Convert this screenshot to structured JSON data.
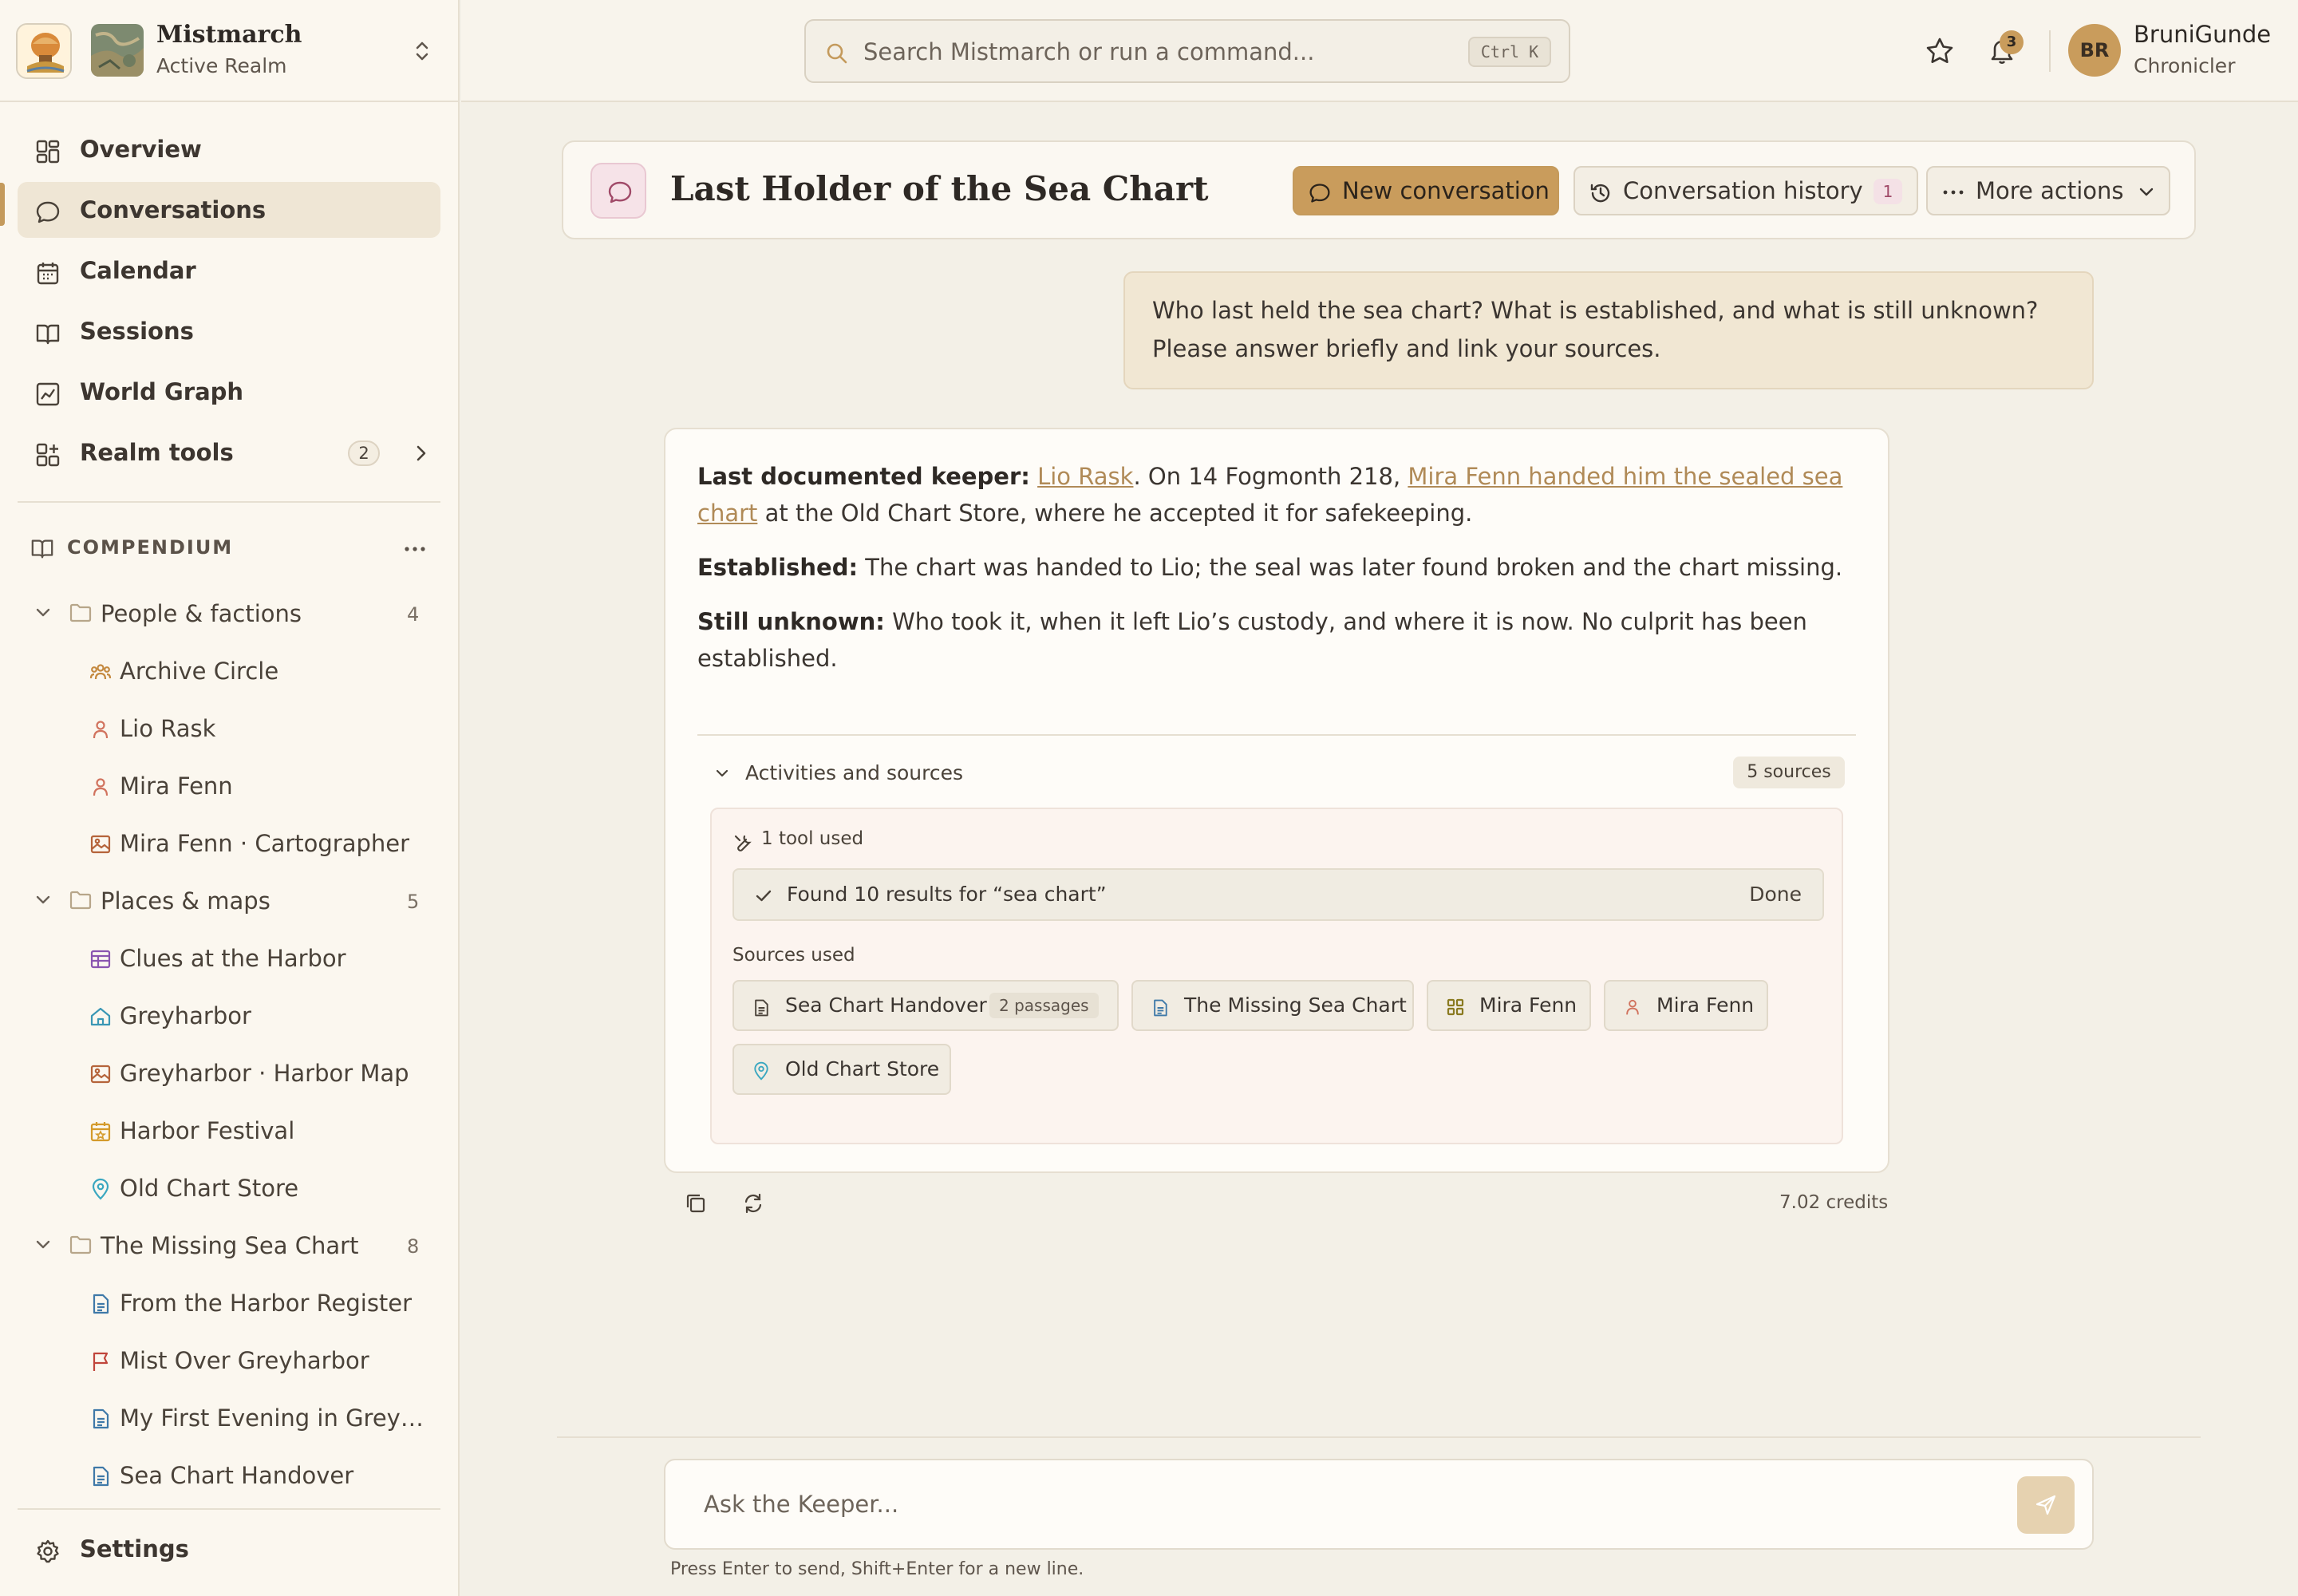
{
  "realm": {
    "name": "Mistmarch",
    "subtitle": "Active Realm"
  },
  "nav": {
    "overview": "Overview",
    "conversations": "Conversations",
    "calendar": "Calendar",
    "sessions": "Sessions",
    "world_graph": "World Graph",
    "realm_tools": "Realm tools",
    "realm_tools_count": "2",
    "settings": "Settings"
  },
  "compendium": {
    "title": "COMPENDIUM",
    "folders": [
      {
        "label": "People & factions",
        "count": "4",
        "items": [
          "Archive Circle",
          "Lio Rask",
          "Mira Fenn",
          "Mira Fenn · Cartographer"
        ]
      },
      {
        "label": "Places & maps",
        "count": "5",
        "items": [
          "Clues at the Harbor",
          "Greyharbor",
          "Greyharbor · Harbor Map",
          "Harbor Festival",
          "Old Chart Store"
        ]
      },
      {
        "label": "The Missing Sea Chart",
        "count": "8",
        "items": [
          "From the Harbor Register",
          "Mist Over Greyharbor",
          "My First Evening in Grey…",
          "Sea Chart Handover"
        ]
      }
    ]
  },
  "topbar": {
    "search_placeholder": "Search Mistmarch or run a command...",
    "shortcut": "Ctrl K",
    "notifications_count": "3",
    "user_initials": "BR",
    "user_name": "BruniGunde",
    "user_role": "Chronicler"
  },
  "conversation": {
    "title": "Last Holder of the Sea Chart",
    "new_label": "New conversation",
    "history_label": "Conversation history",
    "history_count": "1",
    "more_label": "More actions"
  },
  "user_message": {
    "line1": "Who last held the sea chart? What is established, and what is still unknown?",
    "line2": "Please answer briefly and link your sources."
  },
  "answer": {
    "keeper_label": "Last documented keeper:",
    "keeper_link": "Lio Rask",
    "keeper_text1": ". On 14 Fogmonth 218,",
    "keeper_link2a": "Mira Fenn handed him the sealed sea",
    "keeper_link2b": "chart",
    "keeper_text2": " at the Old Chart Store, where he accepted it for safekeeping.",
    "established_label": "Established:",
    "established_text": " The chart was handed to Lio; the seal was later found broken and the chart missing.",
    "unknown_label": "Still unknown:",
    "unknown_text1": " Who took it, when it left Lio’s custody, and where it is now. No culprit has been",
    "unknown_text2": "established."
  },
  "activities": {
    "header": "Activities and sources",
    "sources_count": "5 sources",
    "tools_used": "1 tool used",
    "result_text": "Found 10 results for “sea chart”",
    "result_status": "Done",
    "sources_used_label": "Sources used",
    "sources": [
      {
        "label": "Sea Chart Handover",
        "icon": "document-icon",
        "passages": "2 passages"
      },
      {
        "label": "The Missing Sea Chart",
        "icon": "document-icon"
      },
      {
        "label": "Mira Fenn",
        "icon": "grid-icon"
      },
      {
        "label": "Mira Fenn",
        "icon": "person-icon"
      },
      {
        "label": "Old Chart Store",
        "icon": "location-pin-icon"
      }
    ]
  },
  "credits": "7.02 credits",
  "composer": {
    "placeholder": "Ask the Keeper...",
    "hint": "Press Enter to send, Shift+Enter for a new line."
  },
  "colors": {
    "accent": "#c99c5c",
    "background": "#f3f0e7",
    "sidebar": "#fbf7ef",
    "link": "#b08a57"
  }
}
